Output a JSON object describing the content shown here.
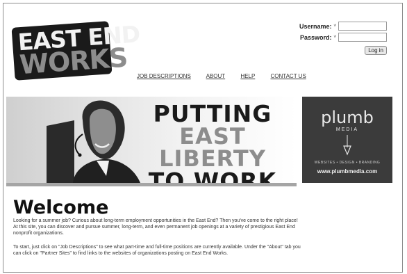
{
  "logo": {
    "line1": "EAST END",
    "line2": "WORKS"
  },
  "login": {
    "username_label": "Username:",
    "password_label": "Password:",
    "required_mark": "*",
    "login_button": "Log in"
  },
  "nav": {
    "items": [
      "JOB DESCRIPTIONS",
      "ABOUT",
      "HELP",
      "CONTACT US"
    ]
  },
  "banner": {
    "line1": "PUTTING",
    "line2": "EAST LIBERTY",
    "line3": "TO WORK"
  },
  "ad": {
    "brand": "plumb",
    "sub": "MEDIA",
    "services": "WEBSITES • DESIGN • BRANDING",
    "url": "www.plumbmedia.com"
  },
  "main": {
    "heading": "Welcome",
    "para1": "Looking for a summer job? Curious about long-term employment opportunities in the East End? Then you've come to the right place! At this site, you can discover and pursue summer, long-term, and even permanent job openings at a variety of prestigious East End nonprofit organizations.",
    "para2": "To start, just click on \"Job Descriptions\" to see what part-time and full-time positions are currently available. Under the \"About\" tab you can click on \"Partner Sites\" to find links to the websites of organizations posting on East End Works."
  }
}
